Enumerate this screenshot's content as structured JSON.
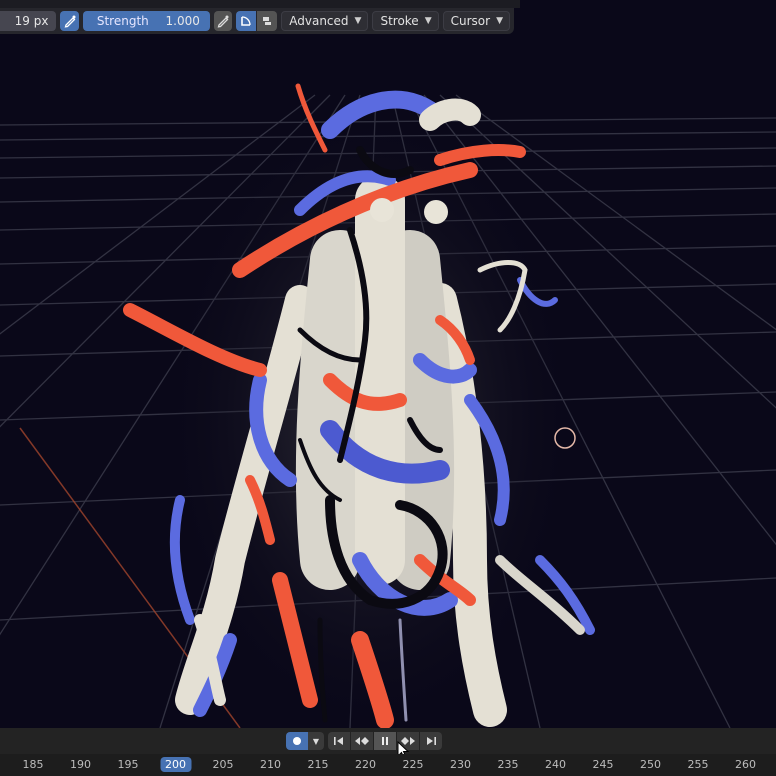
{
  "toolbar": {
    "radius_value": "19 px",
    "strength_label": "Strength",
    "strength_value": "1.000",
    "menus": [
      {
        "label": "Advanced"
      },
      {
        "label": "Stroke"
      },
      {
        "label": "Cursor"
      }
    ]
  },
  "timeline": {
    "frame_labels": [
      "185",
      "190",
      "195",
      "200",
      "205",
      "210",
      "215",
      "220",
      "225",
      "230",
      "235",
      "240",
      "245",
      "250",
      "255",
      "260"
    ],
    "current_frame": "200",
    "accent_color": "#4772b3"
  },
  "viewport": {
    "background": "#0a0819",
    "grid_color": "#3a3a4a",
    "stroke_colors": {
      "red": "#f0583a",
      "blue": "#5b6be0",
      "cream": "#e4e0d4",
      "black": "#0b0a12"
    }
  }
}
